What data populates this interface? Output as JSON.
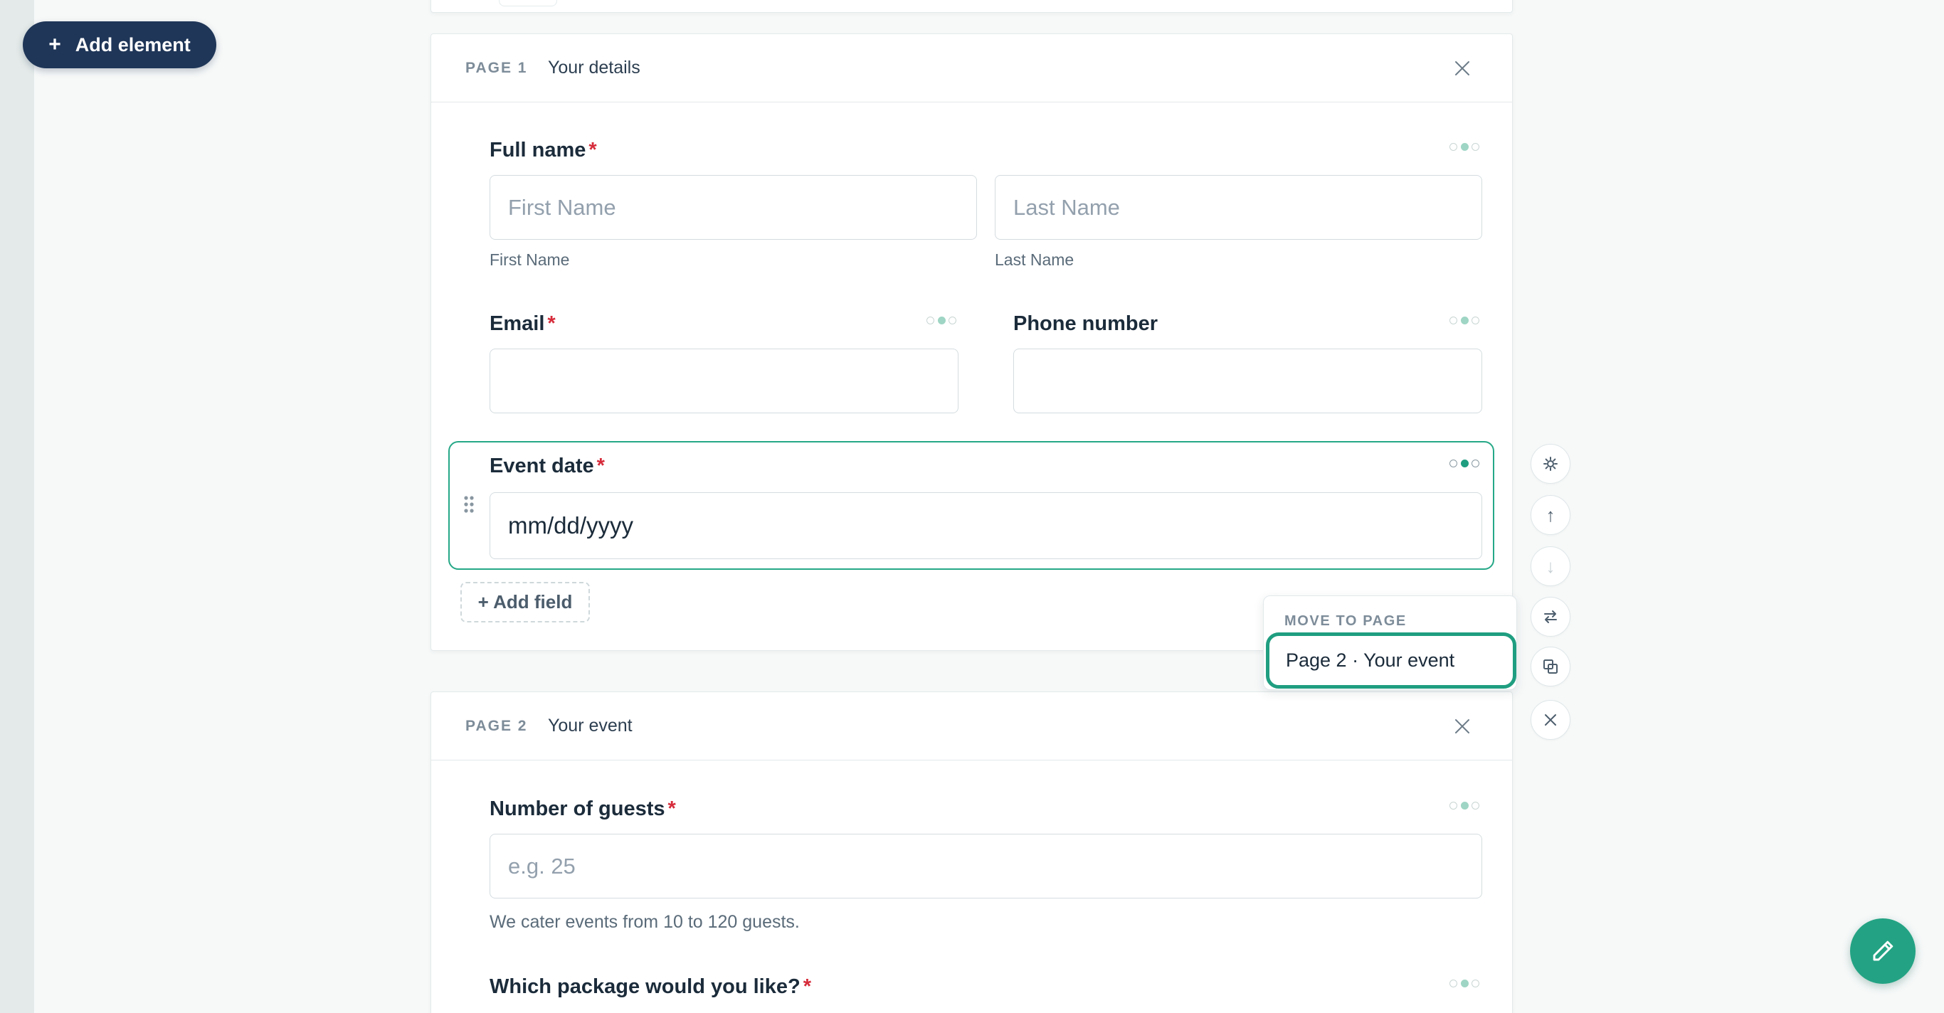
{
  "toolbar": {
    "add_element_label": "Add element",
    "add_element_icon": "plus-icon"
  },
  "pages": [
    {
      "label": "PAGE 1",
      "title": "Your details",
      "fields": {
        "full_name": {
          "label": "Full name",
          "required": "*",
          "first": {
            "placeholder": "First Name",
            "sublabel": "First Name"
          },
          "last": {
            "placeholder": "Last Name",
            "sublabel": "Last Name"
          }
        },
        "email": {
          "label": "Email",
          "required": "*",
          "value": ""
        },
        "phone": {
          "label": "Phone number",
          "value": ""
        },
        "event_date": {
          "label": "Event date",
          "required": "*",
          "placeholder": "mm/dd/yyyy"
        }
      },
      "add_field_label": "+ Add field"
    },
    {
      "label": "PAGE 2",
      "title": "Your event",
      "fields": {
        "guests": {
          "label": "Number of guests",
          "required": "*",
          "placeholder": "e.g. 25",
          "help": "We cater events from 10 to 120 guests."
        },
        "package": {
          "label": "Which package would you like?",
          "required": "*"
        }
      }
    }
  ],
  "rail": {
    "icons": [
      "gear-icon",
      "arrow-up-icon",
      "arrow-down-icon",
      "swap-icon",
      "duplicate-icon",
      "close-icon"
    ],
    "arrow_up": "↑",
    "arrow_down": "↓"
  },
  "move_popover": {
    "title": "MOVE TO PAGE",
    "option": "Page 2 · Your event"
  },
  "colors": {
    "accent": "#26a887",
    "navy": "#1f3658",
    "required": "#d62b3a"
  }
}
